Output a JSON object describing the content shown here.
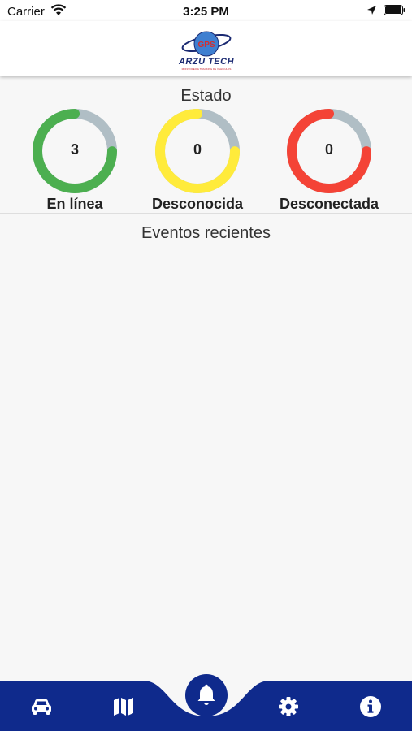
{
  "status_bar": {
    "carrier": "Carrier",
    "time": "3:25 PM"
  },
  "header": {
    "logo_badge": "GPS",
    "logo_brand": "ARZU TECH",
    "logo_tagline": "MONITOREO & TRACKING DE VEHICULOS"
  },
  "estado": {
    "title": "Estado",
    "gauges": [
      {
        "label": "En línea",
        "value": "3",
        "fraction": 0.75,
        "color": "#4caf50"
      },
      {
        "label": "Desconocida",
        "value": "0",
        "fraction": 0.75,
        "color": "#ffeb3b"
      },
      {
        "label": "Desconectada",
        "value": "0",
        "fraction": 0.75,
        "color": "#f44336"
      }
    ],
    "track_color": "#b0bec5"
  },
  "events": {
    "title": "Eventos recientes"
  },
  "nav": {
    "items": [
      {
        "icon": "car-icon"
      },
      {
        "icon": "map-icon"
      },
      {
        "icon": "bell-icon",
        "active": true
      },
      {
        "icon": "gear-icon"
      },
      {
        "icon": "info-icon"
      }
    ],
    "color": "#0f2a8c"
  }
}
